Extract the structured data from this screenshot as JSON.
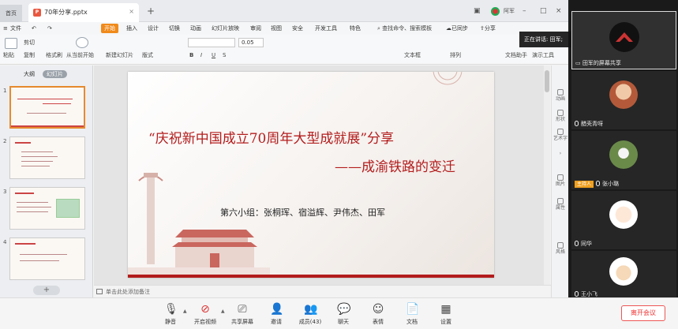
{
  "ppt": {
    "home_tab": "首页",
    "doc_tab": "70年分享.pptx",
    "user_label": "阿军",
    "menu": [
      "文件",
      "开始",
      "插入",
      "设计",
      "切换",
      "动画",
      "幻灯片放映",
      "审阅",
      "视图",
      "安全",
      "开发工具",
      "特色"
    ],
    "search": "查找命令、搜索模板",
    "sync": "已同步",
    "share": "分享",
    "ribbon": {
      "paste": "粘贴",
      "cut": "剪切",
      "copy": "复制",
      "format_painter": "格式刷",
      "play_from_current": "从当前开始",
      "new_slide": "新建幻灯片",
      "layout": "版式",
      "font_size": "0.05",
      "textbox": "文本框",
      "arrange": "排列",
      "text_assistant": "文档助手",
      "presenter_tools": "演示工具"
    },
    "sidebar": {
      "tab_outline": "大纲",
      "tab_slides": "幻灯片",
      "slide_numbers": [
        "1",
        "2",
        "3",
        "4"
      ],
      "add": "+"
    },
    "slide": {
      "title": "“庆祝新中国成立70周年大型成就展”分享",
      "subtitle": "——成渝铁路的变迁",
      "group": "第六小组：张桐珲、宿溢辉、尹伟杰、田军"
    },
    "right_panel": [
      "动画",
      "形状",
      "艺术字",
      "图片",
      "属性",
      "风格"
    ],
    "notes_placeholder": "单击此处添加备注"
  },
  "meeting": {
    "speaker_banner": "正在讲话: 田军;",
    "participants": [
      {
        "name": "田军的屏幕共享"
      },
      {
        "name": "醋壳青呀"
      },
      {
        "name": "张小璐",
        "host_label": "主持人"
      },
      {
        "name": "同华"
      },
      {
        "name": "王小飞"
      }
    ]
  },
  "toolbar": {
    "items": [
      {
        "label": "静音",
        "icon": "microphone-icon"
      },
      {
        "label": "开启视频",
        "icon": "camera-off-icon"
      },
      {
        "label": "共享屏幕",
        "icon": "share-screen-icon"
      },
      {
        "label": "邀请",
        "icon": "invite-icon"
      },
      {
        "label": "成员(43)",
        "icon": "members-icon"
      },
      {
        "label": "聊天",
        "icon": "chat-icon"
      },
      {
        "label": "表情",
        "icon": "emoji-icon"
      },
      {
        "label": "文档",
        "icon": "document-icon"
      },
      {
        "label": "设置",
        "icon": "settings-icon"
      }
    ],
    "leave": "离开会议"
  },
  "colors": {
    "accent_orange": "#f08a1a",
    "slide_red": "#b31c1c",
    "leave_red": "#e33333"
  }
}
